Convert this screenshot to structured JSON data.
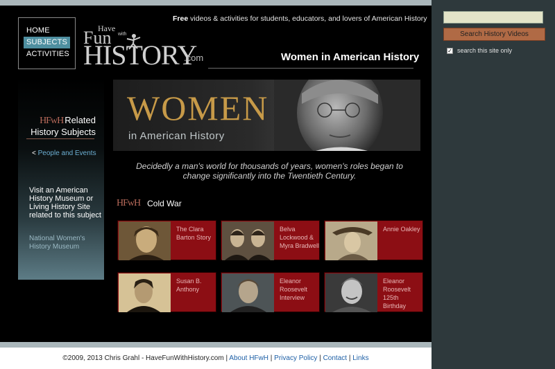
{
  "nav": {
    "items": [
      {
        "label": "HOME"
      },
      {
        "label": "SUBJECTS"
      },
      {
        "label": "ACTIVITIES"
      }
    ]
  },
  "logo": {
    "have": "Have",
    "fun": "Fun",
    "with": "with",
    "history": "HISTORY",
    "com": ".com"
  },
  "header": {
    "tagline_bold": "Free",
    "tagline_rest": " videos & activities for students, educators, and lovers of American History",
    "page_title": "Women in American History"
  },
  "search": {
    "placeholder": "",
    "button_label": "Search History Videos",
    "site_only_label": "search this site only",
    "site_only_checked": true
  },
  "sidebar": {
    "badge": "HFwH",
    "title": "Related History Subjects",
    "link_arrow": "<",
    "link": "People and Events",
    "visit_text": "Visit an American History Museum or Living History Site related to this subject",
    "museum_link": "National Women's History Museum"
  },
  "banner": {
    "big_text": "WOMEN",
    "small_text": "in American History"
  },
  "intro": "Decidedly a man's world for thousands of years, women's roles began to change significantly into the Twentieth Century.",
  "section": {
    "badge": "HFwH",
    "title": "Cold War"
  },
  "cards": [
    {
      "label": "The Clara Barton Story"
    },
    {
      "label": "Belva Lockwood & Myra Bradwell"
    },
    {
      "label": "Annie Oakley"
    },
    {
      "label": "Susan B. Anthony"
    },
    {
      "label": "Eleanor Roosevelt Interview"
    },
    {
      "label": "Eleanor Roosevelt 125th Birthday"
    }
  ],
  "footer": {
    "copyright": "©2009, 2013 Chris Grahl - HaveFunWithHistory.com",
    "sep": "|",
    "links": [
      "About HFwH",
      "Privacy Policy",
      "Contact",
      "Links"
    ]
  },
  "colors": {
    "main_bg": "#000000",
    "right_column": "#2e393c",
    "card_red": "#8c0e14",
    "nav_active": "#4e8fa0",
    "search_button": "#b06a45",
    "link_blue": "#1d5fa6"
  }
}
